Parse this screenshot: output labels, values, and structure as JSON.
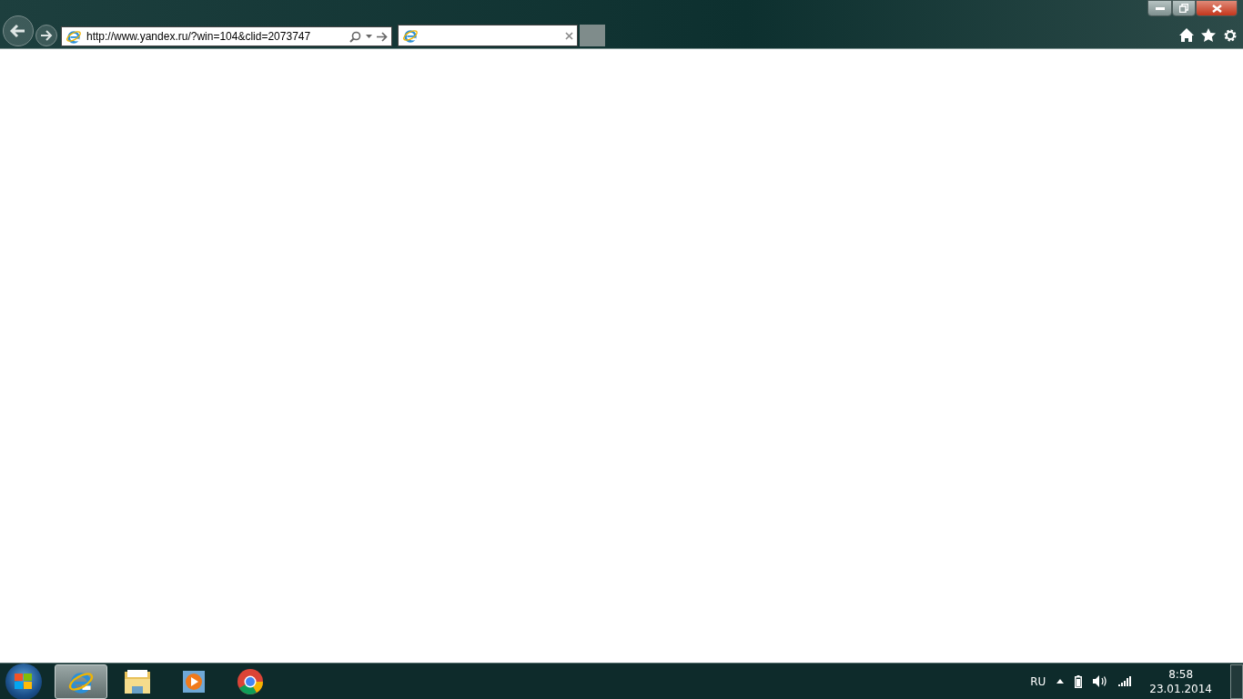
{
  "address_bar": {
    "url": "http://www.yandex.ru/?win=104&clid=2073747"
  },
  "tabs": [
    {
      "selected": true
    }
  ],
  "taskbar": {
    "apps": [
      {
        "kind": "ie",
        "selected": true
      },
      {
        "kind": "explorer",
        "selected": false
      },
      {
        "kind": "media",
        "selected": false
      },
      {
        "kind": "chrome",
        "selected": false
      }
    ],
    "language": "RU",
    "time": "8:58",
    "date": "23.01.2014"
  }
}
